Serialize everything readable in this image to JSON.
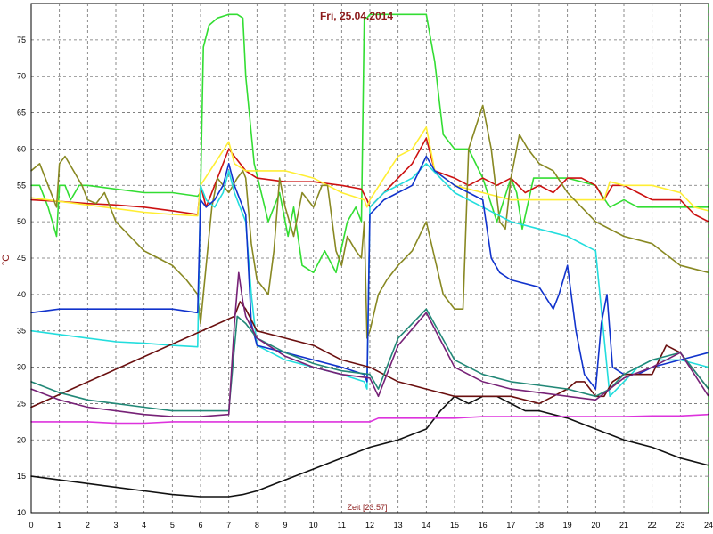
{
  "chart_data": {
    "type": "line",
    "title": "Fri, 25.04.2014",
    "ylabel": "°C",
    "xlabel": "Zeit [23:57]",
    "xlim": [
      0,
      24
    ],
    "ylim": [
      10,
      80
    ],
    "x_ticks": [
      "0",
      "1",
      "2",
      "3",
      "4",
      "5",
      "6",
      "7",
      "8",
      "9",
      "10",
      "11",
      "12",
      "13",
      "14",
      "15",
      "16",
      "17",
      "18",
      "19",
      "20",
      "21",
      "22",
      "23",
      "24"
    ],
    "y_ticks": [
      "10",
      "15",
      "20",
      "25",
      "30",
      "35",
      "40",
      "45",
      "50",
      "55",
      "60",
      "65",
      "70",
      "75"
    ],
    "grid": true,
    "series": [
      {
        "color": "#33dd33",
        "x": [
          0,
          0.3,
          0.6,
          0.9,
          1.0,
          1.2,
          1.4,
          1.7,
          2.0,
          3.0,
          4.0,
          5.0,
          5.9,
          6.0,
          6.1,
          6.3,
          6.6,
          7.0,
          7.3,
          7.5,
          7.6,
          7.9,
          8.4,
          8.8,
          9.1,
          9.3,
          9.6,
          10.0,
          10.4,
          10.8,
          11.2,
          11.5,
          11.7,
          11.8,
          11.9,
          12.0,
          12.2,
          12.5,
          13.0,
          13.5,
          14.0,
          14.3,
          14.6,
          15.0,
          15.5,
          16.0,
          16.5,
          17.0,
          17.2,
          17.4,
          17.8,
          18.2,
          19.0,
          20.0,
          20.5,
          21.0,
          21.5,
          22.0,
          23.0,
          24.0
        ],
        "y": [
          55,
          55,
          52,
          48,
          55,
          55,
          53,
          55,
          55,
          54.5,
          54,
          54,
          53.5,
          54,
          74,
          77,
          78,
          78.5,
          78.5,
          78,
          70,
          58,
          50,
          54,
          48,
          52,
          44,
          43,
          46,
          43,
          50,
          52,
          50,
          78,
          78,
          78.5,
          78.5,
          78.5,
          78.5,
          78.5,
          78.5,
          72,
          62,
          60,
          60,
          56,
          50,
          56,
          54,
          49,
          56,
          56,
          56,
          55,
          52,
          53,
          52,
          52,
          52,
          52
        ]
      },
      {
        "color": "#cc1111",
        "x": [
          0,
          1,
          2,
          3,
          4,
          5,
          5.9,
          6.0,
          6.2,
          6.5,
          7.0,
          7.2,
          7.6,
          8.0,
          9.0,
          10.0,
          11.0,
          11.7,
          11.9,
          12.0,
          12.5,
          13.0,
          13.5,
          14.0,
          14.3,
          15.0,
          15.5,
          16.0,
          16.5,
          17.0,
          17.5,
          18.0,
          18.5,
          19.0,
          19.5,
          20.0,
          20.3,
          20.6,
          21.0,
          21.5,
          22.0,
          23.0,
          23.5,
          24.0
        ],
        "y": [
          53,
          52.8,
          52.5,
          52.3,
          52,
          51.5,
          51,
          55,
          52,
          55,
          60,
          59,
          57,
          56,
          55.5,
          55.5,
          55,
          54.5,
          53,
          52,
          54,
          56,
          58,
          61.5,
          57,
          56,
          55,
          56,
          55,
          56,
          54,
          55,
          54,
          56,
          56,
          55,
          53,
          55,
          55,
          54,
          53,
          53,
          51,
          50
        ]
      },
      {
        "color": "#ffee33",
        "x": [
          0,
          1,
          2,
          3,
          4,
          5,
          5.9,
          6.0,
          6.5,
          7.0,
          7.2,
          7.6,
          8.0,
          9.0,
          10.0,
          11.0,
          11.8,
          11.9,
          12.0,
          12.5,
          13.0,
          13.5,
          14.0,
          14.3,
          15.0,
          16.0,
          17.0,
          18.0,
          19.0,
          20.0,
          20.3,
          20.5,
          21.0,
          22.0,
          23.0,
          23.5,
          24.0
        ],
        "y": [
          53.3,
          52.8,
          52.3,
          51.8,
          51.3,
          51,
          50.8,
          55,
          58,
          61,
          58,
          57,
          57,
          57,
          56,
          54,
          53,
          52,
          53,
          56,
          59,
          60,
          63,
          57,
          55,
          54,
          53,
          53,
          53,
          53,
          53,
          55.5,
          55,
          55,
          54,
          52,
          51.5
        ]
      },
      {
        "color": "#888822",
        "x": [
          0,
          0.3,
          0.6,
          0.9,
          1.0,
          1.2,
          1.5,
          1.8,
          2.0,
          2.3,
          2.6,
          3.0,
          3.5,
          4.0,
          4.5,
          5.0,
          5.5,
          5.9,
          6.0,
          6.2,
          6.4,
          6.6,
          7.0,
          7.3,
          7.5,
          7.6,
          7.8,
          8.0,
          8.4,
          8.6,
          8.8,
          9.0,
          9.3,
          9.6,
          10.0,
          10.3,
          10.5,
          10.8,
          11.0,
          11.2,
          11.5,
          11.7,
          11.8,
          11.9,
          12.0,
          12.3,
          12.6,
          13.0,
          13.5,
          14.0,
          14.3,
          14.6,
          15.0,
          15.3,
          15.5,
          16.0,
          16.3,
          16.6,
          16.8,
          17.0,
          17.3,
          17.6,
          18.0,
          18.5,
          19.0,
          20.0,
          21.0,
          22.0,
          23.0,
          24.0
        ],
        "y": [
          57,
          58,
          55,
          52,
          58,
          59,
          57,
          55,
          53,
          52.5,
          54,
          50,
          48,
          46,
          45,
          44,
          42,
          40,
          36,
          44,
          52,
          56,
          54,
          56,
          57,
          56,
          47,
          42,
          40,
          46,
          56,
          52,
          48,
          54,
          52,
          55,
          55,
          46,
          44,
          48,
          46,
          45,
          50,
          34,
          35,
          40,
          42,
          44,
          46,
          50,
          45,
          40,
          38,
          38,
          60,
          66,
          60,
          50,
          49,
          56,
          62,
          60,
          58,
          57,
          54,
          50,
          48,
          47,
          44,
          43
        ]
      },
      {
        "color": "#22dddd",
        "x": [
          0,
          1,
          2,
          3,
          4,
          5,
          5.9,
          6.0,
          6.2,
          6.5,
          6.8,
          7.0,
          7.2,
          7.4,
          7.6,
          7.8,
          8.0,
          9.0,
          10.0,
          11.0,
          11.8,
          11.9,
          12.0,
          12.5,
          13.0,
          13.5,
          14.0,
          14.5,
          15.0,
          16.0,
          17.0,
          18.0,
          19.0,
          20.0,
          20.5,
          21.0,
          21.5,
          22.0,
          23.0,
          24.0
        ],
        "y": [
          35,
          34.5,
          34,
          33.5,
          33.3,
          33,
          32.8,
          55,
          53,
          52,
          54,
          57,
          54,
          52,
          50,
          40,
          33,
          31,
          30,
          29,
          28,
          27,
          52,
          54,
          55,
          56,
          58,
          56,
          54,
          52,
          50,
          49,
          48,
          46,
          26,
          28,
          30,
          31,
          31,
          30
        ]
      },
      {
        "color": "#1133cc",
        "x": [
          0,
          1,
          2,
          3,
          4,
          5,
          5.9,
          6.0,
          6.2,
          6.5,
          6.8,
          7.0,
          7.2,
          7.4,
          7.6,
          7.8,
          8.0,
          9.0,
          10.0,
          11.0,
          11.8,
          11.9,
          12.0,
          12.5,
          13.0,
          13.5,
          14.0,
          14.3,
          15.0,
          15.5,
          16.0,
          16.3,
          16.6,
          17.0,
          18.0,
          18.5,
          18.7,
          19.0,
          19.3,
          19.6,
          20.0,
          20.2,
          20.4,
          20.6,
          21.0,
          21.5,
          22.0,
          23.0,
          24.0
        ],
        "y": [
          37.5,
          38,
          38,
          38,
          38,
          38,
          37.5,
          53,
          52,
          53,
          55,
          58,
          55,
          53,
          51,
          36,
          33,
          32,
          31,
          30,
          29,
          28,
          51,
          53,
          54,
          55,
          59,
          57,
          55,
          54,
          53,
          45,
          43,
          42,
          41,
          38,
          40,
          44,
          35,
          29,
          27,
          36,
          40,
          30,
          29,
          29,
          30,
          31,
          32
        ]
      },
      {
        "color": "#111111",
        "x": [
          0,
          1,
          2,
          3,
          4,
          5,
          6,
          7,
          7.5,
          8.0,
          9.0,
          10.0,
          11.0,
          12.0,
          13.0,
          14.0,
          14.5,
          15.0,
          15.5,
          16.0,
          16.5,
          17.0,
          17.5,
          18.0,
          19.0,
          20.0,
          21.0,
          22.0,
          23.0,
          24.0
        ],
        "y": [
          15,
          14.5,
          14,
          13.5,
          13,
          12.5,
          12.2,
          12.2,
          12.5,
          13,
          14.5,
          16,
          17.5,
          19,
          20,
          21.5,
          24,
          26,
          25,
          26,
          26,
          25,
          24,
          24,
          23,
          21.5,
          20,
          19,
          17.5,
          16.5
        ]
      },
      {
        "color": "#dd33dd",
        "x": [
          0,
          1,
          2,
          3,
          4,
          5,
          6,
          7,
          8,
          9,
          10,
          11,
          12,
          12.3,
          12.6,
          13,
          14,
          15,
          16,
          17,
          18,
          19,
          20,
          21,
          22,
          23,
          24
        ],
        "y": [
          22.5,
          22.5,
          22.5,
          22.3,
          22.3,
          22.5,
          22.5,
          22.5,
          22.5,
          22.5,
          22.5,
          22.5,
          22.5,
          23,
          23,
          23,
          23,
          23,
          23.2,
          23.2,
          23.2,
          23.2,
          23.2,
          23.2,
          23.3,
          23.3,
          23.5
        ]
      },
      {
        "color": "#6a0f0f",
        "x": [
          0,
          7.2,
          7.4,
          7.6,
          8.0,
          9.0,
          10.0,
          11.0,
          12.0,
          13.0,
          14.0,
          15.0,
          16.0,
          17.0,
          18.0,
          18.5,
          19.0,
          19.3,
          19.6,
          20.0,
          20.3,
          20.6,
          21.0,
          22.0,
          22.5,
          23.0,
          24.0
        ],
        "y": [
          24.5,
          37,
          39,
          38,
          35,
          34,
          33,
          31,
          30,
          28,
          27,
          26,
          26,
          26,
          25,
          26,
          27,
          28,
          28,
          26,
          26,
          28,
          29,
          29,
          33,
          32,
          27
        ]
      },
      {
        "color": "#228877",
        "x": [
          0,
          1,
          2,
          3,
          4,
          5,
          6,
          7.0,
          7.3,
          7.6,
          8.0,
          9.0,
          10.0,
          11.0,
          12.0,
          12.3,
          13.0,
          14.0,
          15.0,
          16.0,
          17.0,
          18.0,
          19.0,
          20.0,
          20.5,
          21.0,
          22.0,
          23.0,
          24.0
        ],
        "y": [
          28,
          26.5,
          25.5,
          25,
          24.5,
          24,
          24,
          24,
          37,
          36,
          34,
          32,
          30.5,
          29.5,
          29,
          27,
          34,
          38,
          31,
          29,
          28,
          27.5,
          27,
          26,
          27,
          29,
          31,
          32,
          27
        ]
      },
      {
        "color": "#772277",
        "x": [
          0,
          1,
          2,
          3,
          4,
          5,
          6,
          7.0,
          7.2,
          7.35,
          7.5,
          7.6,
          8.0,
          9.0,
          10.0,
          11.0,
          12.0,
          12.3,
          13.0,
          14.0,
          15.0,
          16.0,
          17.0,
          18.0,
          19.0,
          20.0,
          20.5,
          21.0,
          22.0,
          23.0,
          24.0
        ],
        "y": [
          27,
          25.5,
          24.5,
          24,
          23.5,
          23.2,
          23.2,
          23.5,
          36,
          43,
          39,
          37,
          34,
          31.5,
          30,
          29,
          28.5,
          26,
          33,
          37.5,
          30,
          28,
          27,
          26.5,
          26,
          25.5,
          27,
          28.5,
          30,
          32,
          26
        ]
      }
    ]
  }
}
